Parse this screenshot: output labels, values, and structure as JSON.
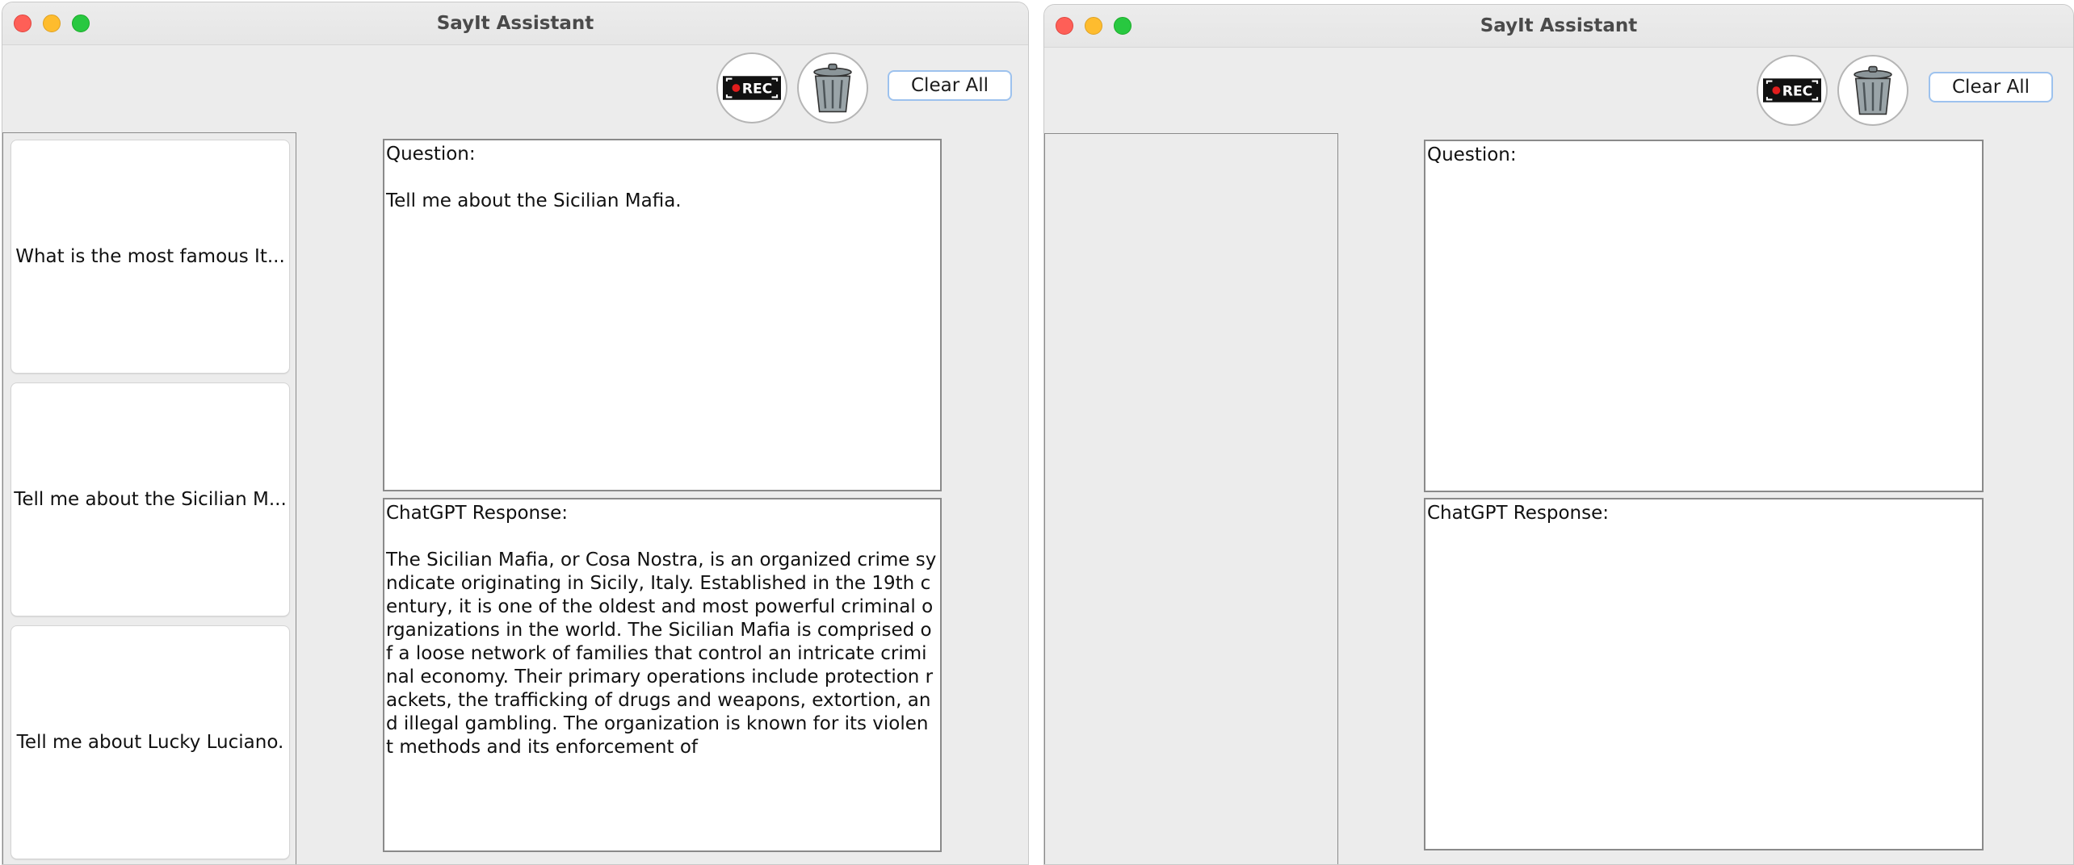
{
  "windows": [
    {
      "title": "SayIt Assistant",
      "rec_icon_label": "REC",
      "clear_label": "Clear All",
      "history": [
        "What is the most famous It...",
        "Tell me about the Sicilian M...",
        "Tell me about Lucky Luciano."
      ],
      "question_label": "Question:",
      "question_text": "Tell me about the Sicilian Mafia.",
      "response_label": "ChatGPT Response:",
      "response_text": "The Sicilian Mafia, or Cosa Nostra, is an organized crime sy\nndicate originating in Sicily, Italy. Established in the 19th c\nentury, it is one of the oldest and most powerful criminal o\nrganizations in the world. The Sicilian Mafia is comprised o\nf a loose network of families that control an intricate crimi\nnal economy. Their primary operations include protection r\nackets, the trafficking of drugs and weapons, extortion, an\nd illegal gambling. The organization is known for its violen\nt methods and its enforcement of"
    },
    {
      "title": "SayIt Assistant",
      "rec_icon_label": "REC",
      "clear_label": "Clear All",
      "history": [],
      "question_label": "Question:",
      "question_text": "",
      "response_label": "ChatGPT Response:",
      "response_text": ""
    }
  ]
}
